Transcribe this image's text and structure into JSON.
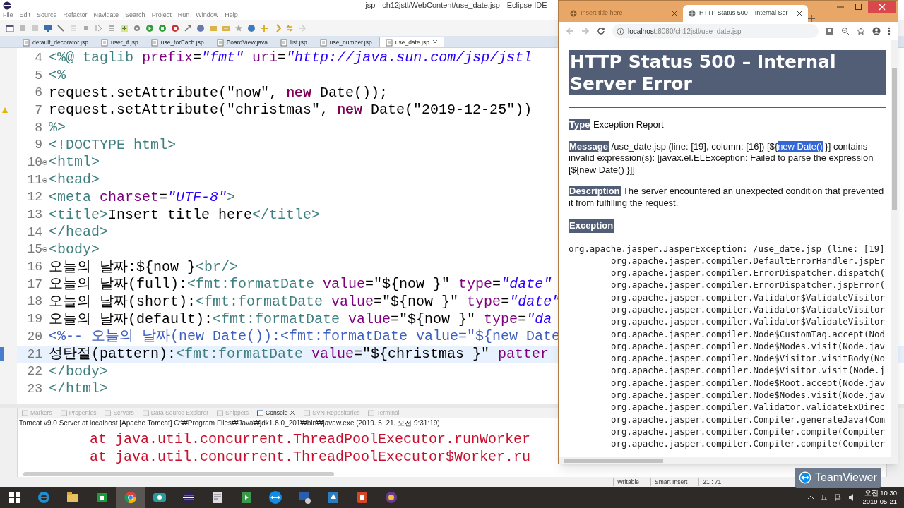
{
  "eclipse": {
    "title": "jsp - ch12jstl/WebContent/use_date.jsp - Eclipse IDE",
    "menu": [
      "File",
      "Edit",
      "Source",
      "Refactor",
      "Navigate",
      "Search",
      "Project",
      "Run",
      "Window",
      "Help"
    ],
    "editor_tabs": [
      {
        "label": "default_decorator.jsp",
        "kind": "jsp",
        "selected": false
      },
      {
        "label": "user_if.jsp",
        "kind": "jsp",
        "selected": false
      },
      {
        "label": "use_forEach.jsp",
        "kind": "jsp",
        "selected": false
      },
      {
        "label": "BoardView.java",
        "kind": "java",
        "selected": false
      },
      {
        "label": "list.jsp",
        "kind": "jsp",
        "selected": false
      },
      {
        "label": "use_number.jsp",
        "kind": "jsp",
        "selected": false
      },
      {
        "label": "use_date.jsp",
        "kind": "jsp",
        "selected": true
      }
    ],
    "code_lines": [
      {
        "number": "4",
        "kind": "plain",
        "segments": [
          {
            "text": "<%@ taglib",
            "kind": "tag"
          },
          {
            "text": " prefix",
            "kind": "attr"
          },
          {
            "text": "=",
            "kind": "text"
          },
          {
            "text": "\"fmt\"",
            "kind": "str"
          },
          {
            "text": " uri",
            "kind": "attr"
          },
          {
            "text": "=",
            "kind": "text"
          },
          {
            "text": "\"http://java.sun.com/jsp/jstl",
            "kind": "str"
          }
        ]
      },
      {
        "number": "5",
        "kind": "plain",
        "segments": [
          {
            "text": "<%",
            "kind": "tag"
          }
        ]
      },
      {
        "number": "6",
        "kind": "plain",
        "segments": [
          {
            "text": "request.setAttribute(\"now\", ",
            "kind": "text"
          },
          {
            "text": "new",
            "kind": "kw"
          },
          {
            "text": " Date());",
            "kind": "text"
          }
        ]
      },
      {
        "number": "7",
        "kind": "warning",
        "segments": [
          {
            "text": "request.setAttribute(\"christmas\", ",
            "kind": "text"
          },
          {
            "text": "new",
            "kind": "kw"
          },
          {
            "text": " Date(\"2019-12-25\"))",
            "kind": "text"
          }
        ]
      },
      {
        "number": "8",
        "kind": "plain",
        "segments": [
          {
            "text": "%>",
            "kind": "tag"
          }
        ]
      },
      {
        "number": "9",
        "kind": "plain",
        "segments": [
          {
            "text": "<!DOCTYPE html>",
            "kind": "tag"
          }
        ]
      },
      {
        "number": "10",
        "kind": "plain",
        "fold": true,
        "segments": [
          {
            "text": "<html>",
            "kind": "tag"
          }
        ]
      },
      {
        "number": "11",
        "kind": "plain",
        "fold": true,
        "segments": [
          {
            "text": "<head>",
            "kind": "tag"
          }
        ]
      },
      {
        "number": "12",
        "kind": "plain",
        "segments": [
          {
            "text": "<meta",
            "kind": "tag"
          },
          {
            "text": " charset",
            "kind": "attr"
          },
          {
            "text": "=",
            "kind": "text"
          },
          {
            "text": "\"UTF-8\"",
            "kind": "str"
          },
          {
            "text": ">",
            "kind": "tag"
          }
        ]
      },
      {
        "number": "13",
        "kind": "plain",
        "segments": [
          {
            "text": "<title>",
            "kind": "tag"
          },
          {
            "text": "Insert title here",
            "kind": "text"
          },
          {
            "text": "</title>",
            "kind": "tag"
          }
        ]
      },
      {
        "number": "14",
        "kind": "plain",
        "segments": [
          {
            "text": "</head>",
            "kind": "tag"
          }
        ]
      },
      {
        "number": "15",
        "kind": "plain",
        "fold": true,
        "segments": [
          {
            "text": "<body>",
            "kind": "tag"
          }
        ]
      },
      {
        "number": "16",
        "kind": "plain",
        "segments": [
          {
            "text": "오늘의 날짜:${now }",
            "kind": "text"
          },
          {
            "text": "<br/>",
            "kind": "tag"
          }
        ]
      },
      {
        "number": "17",
        "kind": "plain",
        "segments": [
          {
            "text": "오늘의 날짜(full):",
            "kind": "text"
          },
          {
            "text": "<fmt:formatDate",
            "kind": "tag"
          },
          {
            "text": " value",
            "kind": "attr"
          },
          {
            "text": "=\"${now }\"",
            "kind": "text"
          },
          {
            "text": " type",
            "kind": "attr"
          },
          {
            "text": "=",
            "kind": "text"
          },
          {
            "text": "\"date\"",
            "kind": "str"
          }
        ]
      },
      {
        "number": "18",
        "kind": "plain",
        "segments": [
          {
            "text": "오늘의 날짜(short):",
            "kind": "text"
          },
          {
            "text": "<fmt:formatDate",
            "kind": "tag"
          },
          {
            "text": " value",
            "kind": "attr"
          },
          {
            "text": "=\"${now }\"",
            "kind": "text"
          },
          {
            "text": " type",
            "kind": "attr"
          },
          {
            "text": "=",
            "kind": "text"
          },
          {
            "text": "\"date\"",
            "kind": "str"
          }
        ]
      },
      {
        "number": "19",
        "kind": "plain",
        "segments": [
          {
            "text": "오늘의 날짜(default):",
            "kind": "text"
          },
          {
            "text": "<fmt:formatDate",
            "kind": "tag"
          },
          {
            "text": " value",
            "kind": "attr"
          },
          {
            "text": "=\"${now }\"",
            "kind": "text"
          },
          {
            "text": " type",
            "kind": "attr"
          },
          {
            "text": "=",
            "kind": "text"
          },
          {
            "text": "\"da",
            "kind": "str"
          }
        ]
      },
      {
        "number": "20",
        "kind": "plain",
        "segments": [
          {
            "text": "<%-- 오늘의 날짜(new Date()):<fmt:formatDate value=\"${new Date",
            "kind": "comment"
          }
        ]
      },
      {
        "number": "21",
        "kind": "current",
        "segments": [
          {
            "text": "성탄절(pattern):",
            "kind": "text"
          },
          {
            "text": "<fmt:formatDate",
            "kind": "tag"
          },
          {
            "text": " value",
            "kind": "attr"
          },
          {
            "text": "=\"${christmas }\"",
            "kind": "text"
          },
          {
            "text": " patter",
            "kind": "attr"
          }
        ]
      },
      {
        "number": "22",
        "kind": "plain",
        "segments": [
          {
            "text": "</body>",
            "kind": "tag"
          }
        ]
      },
      {
        "number": "23",
        "kind": "plain",
        "segments": [
          {
            "text": "</html>",
            "kind": "tag"
          }
        ]
      }
    ],
    "console": {
      "tabs": [
        {
          "label": "Markers",
          "selected": false
        },
        {
          "label": "Properties",
          "selected": false
        },
        {
          "label": "Servers",
          "selected": false
        },
        {
          "label": "Data Source Explorer",
          "selected": false
        },
        {
          "label": "Snippets",
          "selected": false
        },
        {
          "label": "Console",
          "selected": true
        },
        {
          "label": "SVN Repositories",
          "selected": false
        },
        {
          "label": "Terminal",
          "selected": false
        }
      ],
      "header": "Tomcat v9.0 Server at localhost [Apache Tomcat] C:₩Program Files₩Java₩jdk1.8.0_201₩bin₩javaw.exe (2019. 5. 21. 오전 9:31:19)",
      "lines": [
        "at java.util.concurrent.ThreadPoolExecutor.runWorker",
        "at java.util.concurrent.ThreadPoolExecutor$Worker.ru"
      ]
    },
    "status_bar": [
      "Writable",
      "Smart Insert",
      "21 : 71"
    ]
  },
  "browser": {
    "tabs": [
      {
        "label": "Insert title here",
        "selected": false
      },
      {
        "label": "HTTP Status 500 – Internal Ser",
        "selected": true
      }
    ],
    "url_host": "localhost",
    "url_rest": ":8080/ch12jstl/use_date.jsp",
    "page": {
      "heading": "HTTP Status 500 – Internal Server Error",
      "sections": [
        {
          "label": "Type",
          "before": "Exception Report"
        },
        {
          "label": "Message",
          "before": "/use_date.jsp (line: [19], column: [16]) [${",
          "selected_text": "new Date()",
          "after": " }] contains invalid expression(s): [javax.el.ELException: Failed to parse the expression [${new Date() }]]"
        },
        {
          "label": "Description",
          "before": "The server encountered an unexpected condition that prevented it from fulfilling the request."
        },
        {
          "label": "Exception"
        }
      ],
      "exception": "org.apache.jasper.JasperException: /use_date.jsp (line: [19]",
      "frames": [
        "org.apache.jasper.compiler.DefaultErrorHandler.jspEr",
        "org.apache.jasper.compiler.ErrorDispatcher.dispatch(",
        "org.apache.jasper.compiler.ErrorDispatcher.jspError(",
        "org.apache.jasper.compiler.Validator$ValidateVisitor",
        "org.apache.jasper.compiler.Validator$ValidateVisitor",
        "org.apache.jasper.compiler.Validator$ValidateVisitor",
        "org.apache.jasper.compiler.Node$CustomTag.accept(Nod",
        "org.apache.jasper.compiler.Node$Nodes.visit(Node.jav",
        "org.apache.jasper.compiler.Node$Visitor.visitBody(No",
        "org.apache.jasper.compiler.Node$Visitor.visit(Node.j",
        "org.apache.jasper.compiler.Node$Root.accept(Node.jav",
        "org.apache.jasper.compiler.Node$Nodes.visit(Node.jav",
        "org.apache.jasper.compiler.Validator.validateExDirec",
        "org.apache.jasper.compiler.Compiler.generateJava(Com",
        "org.apache.jasper.compiler.Compiler.compile(Compiler",
        "org.apache.jasper.compiler.Compiler.compile(Compiler"
      ]
    }
  },
  "teamviewer": "TeamViewer",
  "clock": {
    "time": "오전 10:30",
    "date": "2019-05-21"
  }
}
